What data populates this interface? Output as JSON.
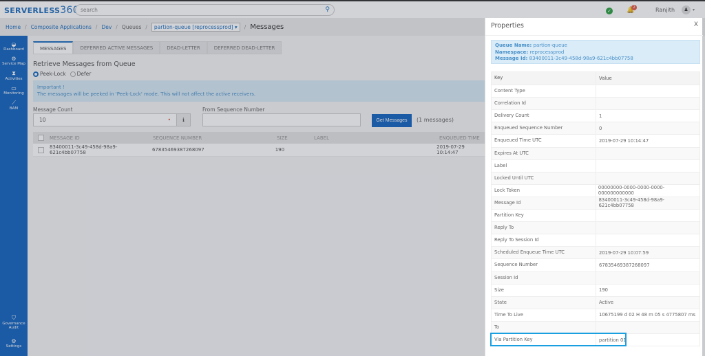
{
  "app": {
    "logo": "SERVERLESS",
    "logo_num": "360",
    "search_placeholder": "search",
    "user": "Ranjith",
    "notifications": "2"
  },
  "breadcrumb": {
    "home": "Home",
    "apps": "Composite Applications",
    "dev": "Dev",
    "queues": "Queues",
    "queue_select": "partion-queue [reprocessprod]",
    "current": "Messages"
  },
  "sidebar": {
    "items": [
      {
        "label": "Dashboard"
      },
      {
        "label": "Service Map"
      },
      {
        "label": "Activities"
      },
      {
        "label": "Monitoring"
      },
      {
        "label": "BAM"
      },
      {
        "label": "Governance Audit"
      },
      {
        "label": "Settings"
      }
    ]
  },
  "tabs": [
    "MESSAGES",
    "DEFERRED ACTIVE MESSAGES",
    "DEAD-LETTER",
    "DEFERRED DEAD-LETTER"
  ],
  "retrieve": {
    "heading": "Retrieve Messages from Queue",
    "opt1": "Peek-Lock",
    "opt2": "Defer",
    "selected": "Peek-Lock",
    "alert_title": "Important !",
    "alert_text": "The messages will be peeked in 'Peek-Lock' mode. This will not affect the active receivers.",
    "count_label": "Message Count",
    "count_value": "10",
    "seq_label": "From Sequence Number",
    "seq_value": "",
    "button": "Get Messages",
    "result": "(1 messages)"
  },
  "table": {
    "headers": [
      "MESSAGE ID",
      "SEQUENCE NUMBER",
      "SIZE",
      "LABEL",
      "ENQUEUED TIME"
    ],
    "rows": [
      [
        "83400011-3c49-458d-98a9-621c4bb07758",
        "67835469387268097",
        "190",
        "",
        "2019-07-29 10:14:47"
      ]
    ]
  },
  "properties": {
    "title": "Properties",
    "close": "X",
    "queue_label": "Queue Name:",
    "queue": "partion-queue",
    "ns_label": "Namespace:",
    "ns": "reprocessprod",
    "id_label": "Message Id:",
    "id": "83400011-3c49-458d-98a9-621c4bb07758",
    "key_header": "Key",
    "value_header": "Value",
    "rows": [
      [
        "Content Type",
        ""
      ],
      [
        "Correlation Id",
        ""
      ],
      [
        "Delivery Count",
        "1"
      ],
      [
        "Enqueued Sequence Number",
        "0"
      ],
      [
        "Enqueued Time UTC",
        "2019-07-29 10:14:47"
      ],
      [
        "Expires At UTC",
        ""
      ],
      [
        "Label",
        ""
      ],
      [
        "Locked Until UTC",
        ""
      ],
      [
        "Lock Token",
        "00000000-0000-0000-0000-000000000000"
      ],
      [
        "Message Id",
        "83400011-3c49-458d-98a9-621c4bb07758"
      ],
      [
        "Partition Key",
        ""
      ],
      [
        "Reply To",
        ""
      ],
      [
        "Reply To Session Id",
        ""
      ],
      [
        "Scheduled Enqueue Time UTC",
        "2019-07-29 10:07:59"
      ],
      [
        "Sequence Number",
        "67835469387268097"
      ],
      [
        "Session Id",
        ""
      ],
      [
        "Size",
        "190"
      ],
      [
        "State",
        "Active"
      ],
      [
        "Time To Live",
        "10675199 d 02 H 48 m 05 s 4775807 ms"
      ],
      [
        "To",
        ""
      ],
      [
        "Via Partition Key",
        "partition 01"
      ]
    ]
  }
}
